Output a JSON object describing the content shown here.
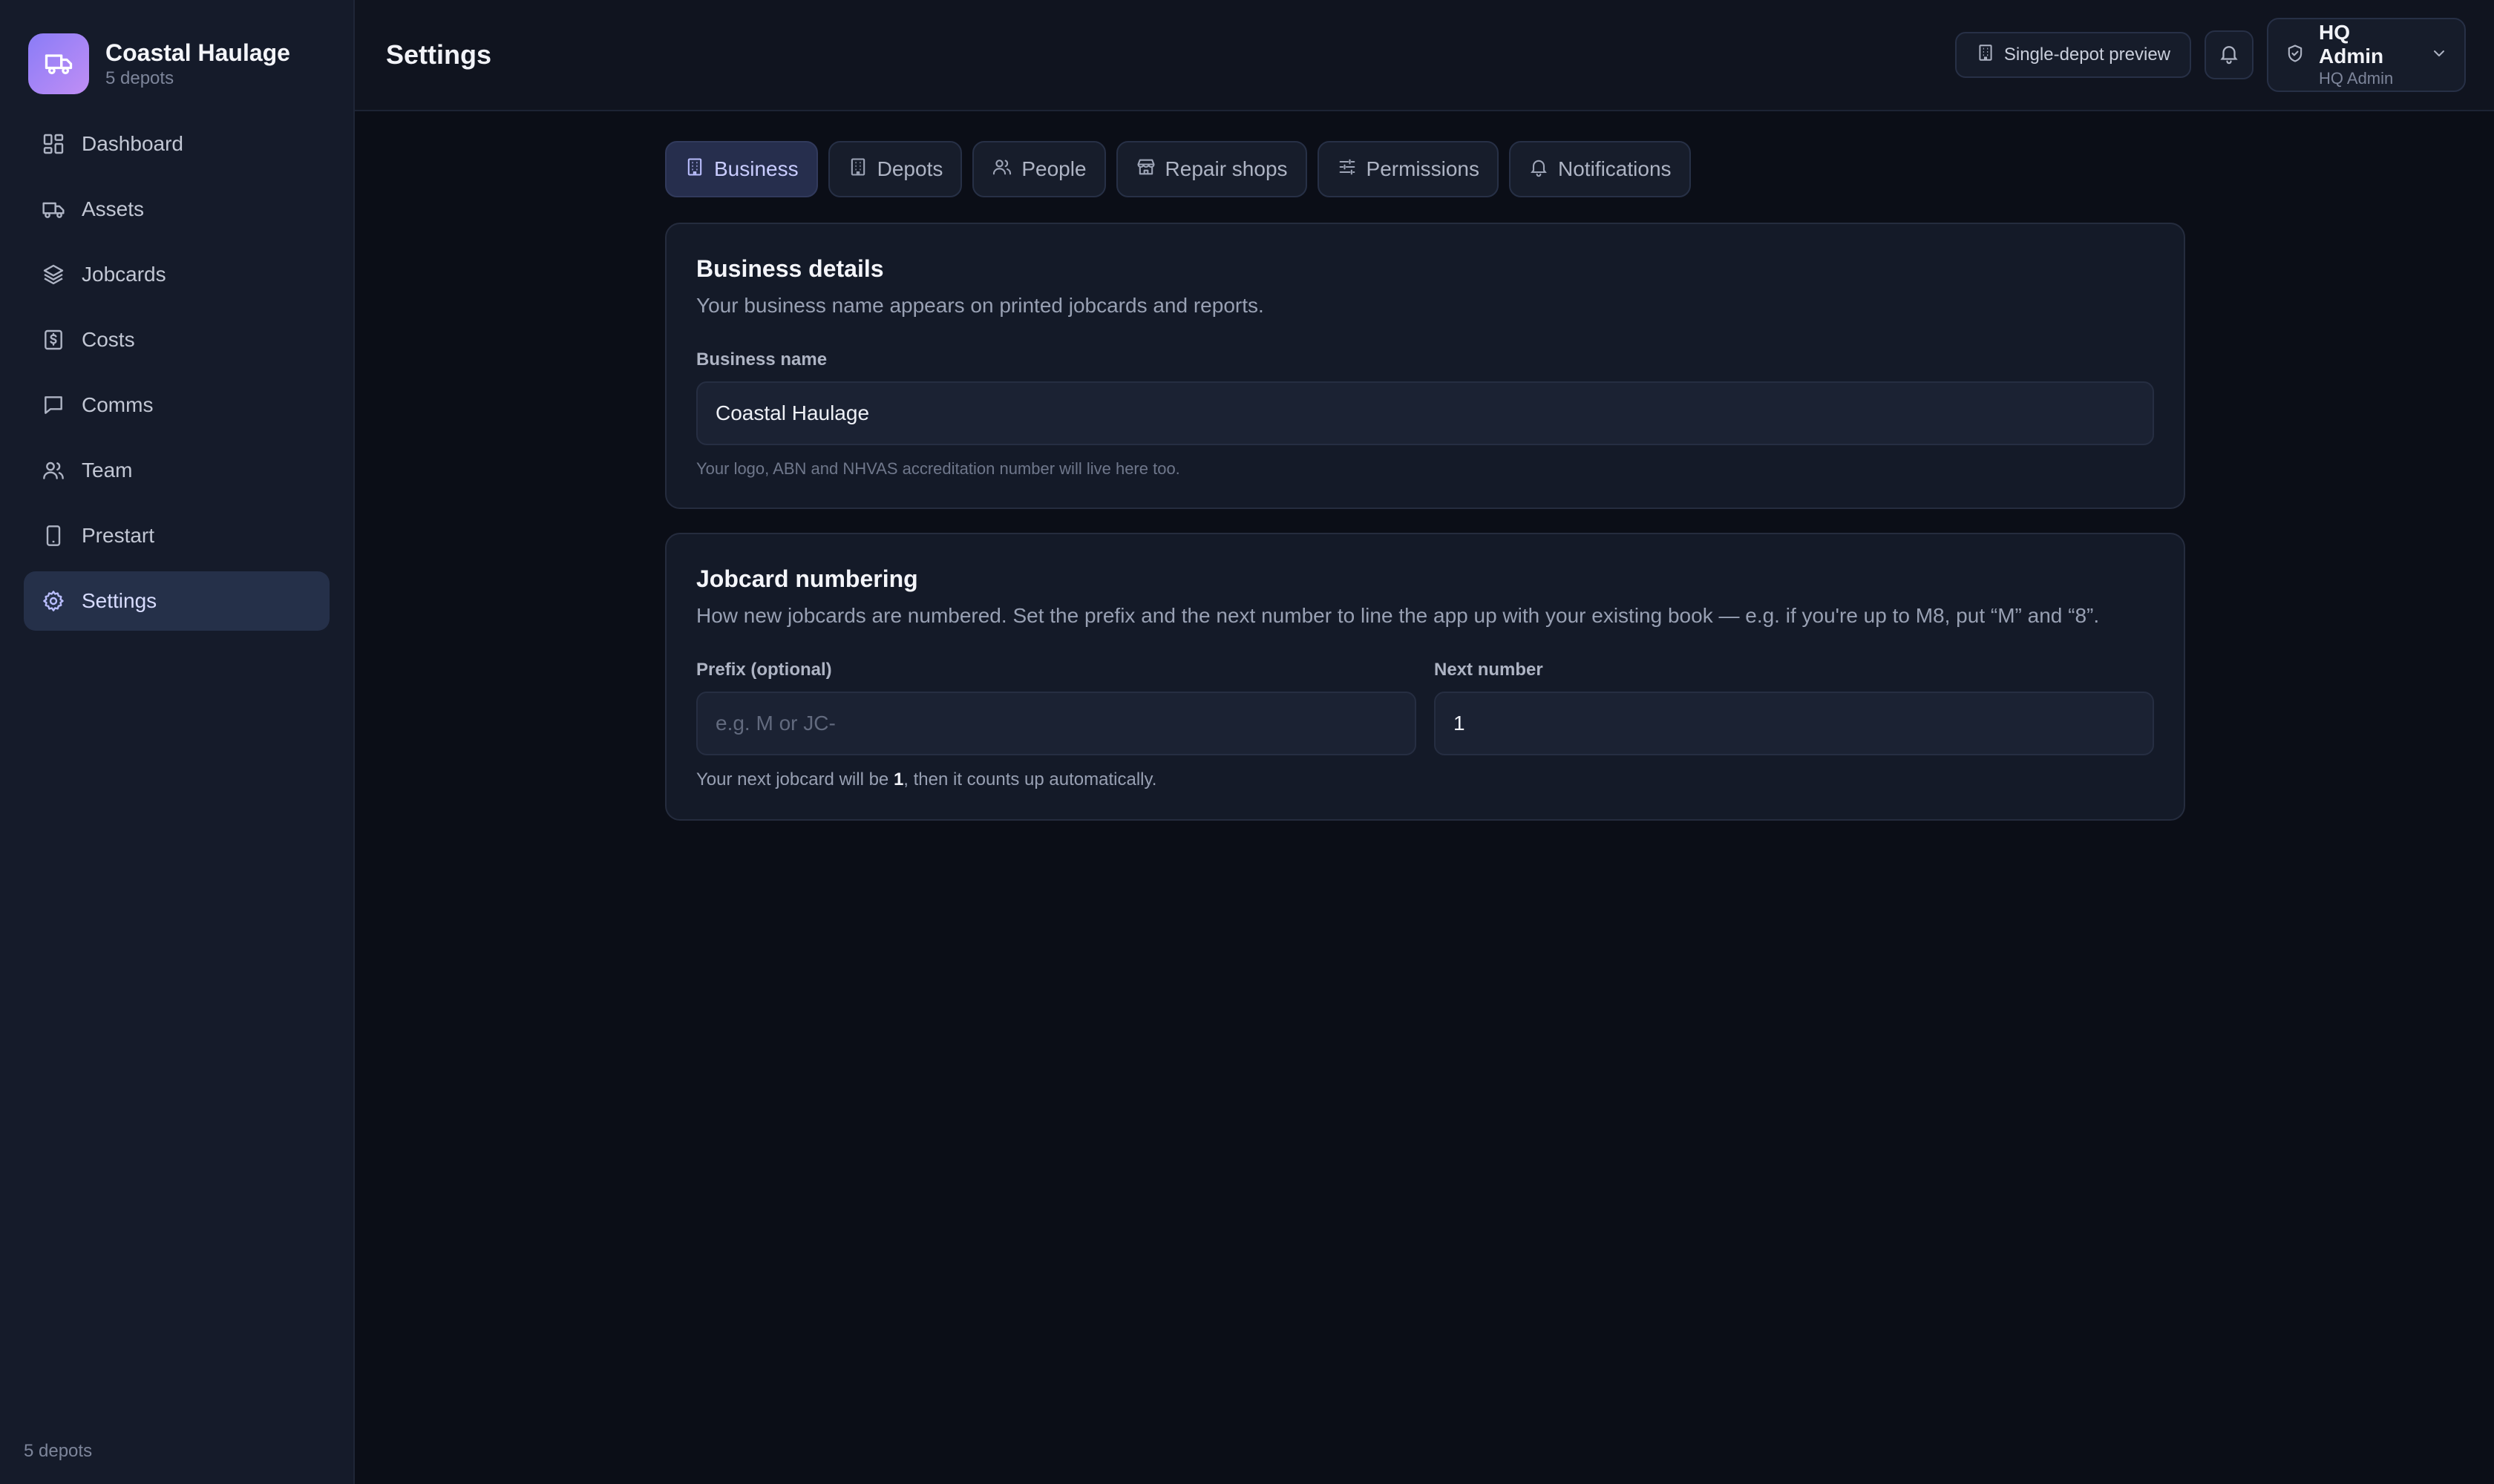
{
  "sidebar": {
    "brand_name": "Coastal Haulage",
    "brand_sub": "5 depots",
    "items": [
      {
        "label": "Dashboard",
        "icon": "dashboard-icon"
      },
      {
        "label": "Assets",
        "icon": "truck-icon"
      },
      {
        "label": "Jobcards",
        "icon": "layers-icon"
      },
      {
        "label": "Costs",
        "icon": "dollar-receipt-icon"
      },
      {
        "label": "Comms",
        "icon": "message-icon"
      },
      {
        "label": "Team",
        "icon": "users-icon"
      },
      {
        "label": "Prestart",
        "icon": "phone-icon"
      },
      {
        "label": "Settings",
        "icon": "gear-icon",
        "active": true
      }
    ],
    "footer": "5 depots"
  },
  "header": {
    "title": "Settings",
    "preview_label": "Single-depot preview",
    "user_name": "HQ Admin",
    "user_role": "HQ Admin"
  },
  "tabs": [
    {
      "label": "Business",
      "icon": "building-icon",
      "active": true
    },
    {
      "label": "Depots",
      "icon": "building-icon"
    },
    {
      "label": "People",
      "icon": "users-icon"
    },
    {
      "label": "Repair shops",
      "icon": "store-icon"
    },
    {
      "label": "Permissions",
      "icon": "sliders-icon"
    },
    {
      "label": "Notifications",
      "icon": "bell-icon"
    }
  ],
  "business": {
    "title": "Business details",
    "desc": "Your business name appears on printed jobcards and reports.",
    "name_label": "Business name",
    "name_value": "Coastal Haulage",
    "hint": "Your logo, ABN and NHVAS accreditation number will live here too."
  },
  "numbering": {
    "title": "Jobcard numbering",
    "desc": "How new jobcards are numbered. Set the prefix and the next number to line the app up with your existing book — e.g. if you're up to M8, put “M” and “8”.",
    "prefix_label": "Prefix (optional)",
    "prefix_placeholder": "e.g. M or JC-",
    "prefix_value": "",
    "next_label": "Next number",
    "next_value": "1",
    "preview_before": "Your next jobcard will be ",
    "preview_number": "1",
    "preview_after": ", then it counts up automatically."
  },
  "colors": {
    "accent": "#b9bdfd",
    "brand_gradient_start": "#8a7cf6",
    "brand_gradient_end": "#c08ef5",
    "background": "#0b0e17",
    "sidebar": "#151b2a"
  }
}
